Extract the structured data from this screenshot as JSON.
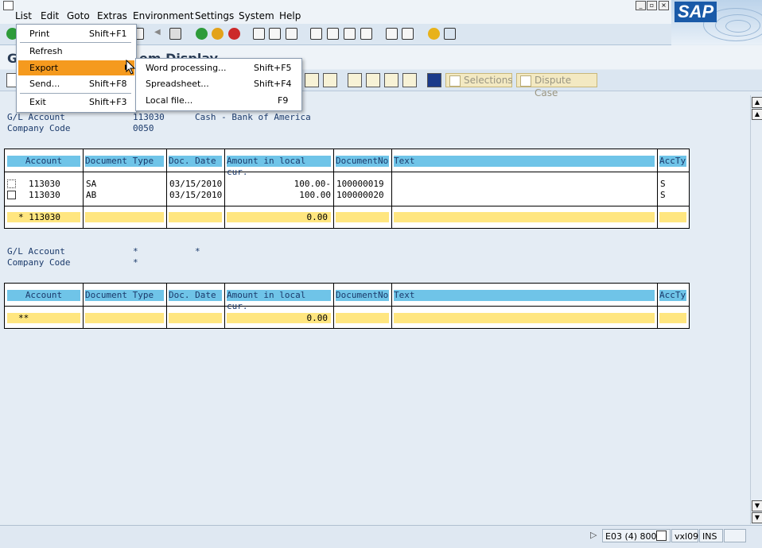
{
  "menubar": {
    "items": [
      "List",
      "Edit",
      "Goto",
      "Extras",
      "Environment",
      "Settings",
      "System",
      "Help"
    ],
    "logo_text": "SAP"
  },
  "title": "G/L Account Line Item Display",
  "title_visible_prefix": "G",
  "title_visible_suffix": "em Display",
  "app_toolbar": {
    "selections_label": "Selections",
    "dispute_label": "Dispute Case"
  },
  "header1": {
    "gl_label": "G/L Account",
    "gl_value": "113030",
    "gl_desc": "Cash - Bank of America",
    "cc_label": "Company Code",
    "cc_value": "0050"
  },
  "header2": {
    "gl_label": "G/L Account",
    "gl_value": "*",
    "gl_desc": "*",
    "cc_label": "Company Code",
    "cc_value": "*"
  },
  "table": {
    "columns": [
      "Account",
      "Document Type",
      "Doc. Date",
      "Amount in local cur.",
      "DocumentNo",
      "Text",
      "AccTy"
    ]
  },
  "table1_rows": [
    {
      "account": "113030",
      "doctype": "SA",
      "date": "03/15/2010",
      "amount": "100.00-",
      "docno": "100000019",
      "text": "",
      "accty": "S"
    },
    {
      "account": "113030",
      "doctype": "AB",
      "date": "03/15/2010",
      "amount": "100.00",
      "docno": "100000020",
      "text": "",
      "accty": "S"
    }
  ],
  "table1_total": {
    "account": "* 113030",
    "amount": "0.00"
  },
  "table2_total": {
    "account": "**",
    "amount": "0.00"
  },
  "list_menu": {
    "items": [
      {
        "label": "Print",
        "shortcut": "Shift+F1"
      },
      {
        "label": "Refresh",
        "shortcut": ""
      },
      {
        "label": "Export",
        "shortcut": ""
      },
      {
        "label": "Send...",
        "shortcut": "Shift+F8"
      },
      {
        "label": "Exit",
        "shortcut": "Shift+F3"
      }
    ]
  },
  "export_menu": {
    "items": [
      {
        "label": "Word processing...",
        "shortcut": "Shift+F5"
      },
      {
        "label": "Spreadsheet...",
        "shortcut": "Shift+F4"
      },
      {
        "label": "Local file...",
        "shortcut": "F9"
      }
    ]
  },
  "statusbar": {
    "system": "E03 (4) 800",
    "server": "vxl09",
    "mode": "INS"
  },
  "colors": {
    "menu_highlight": "#f59a1e",
    "header_cell": "#6fc4e8",
    "total_row": "#ffe680"
  }
}
